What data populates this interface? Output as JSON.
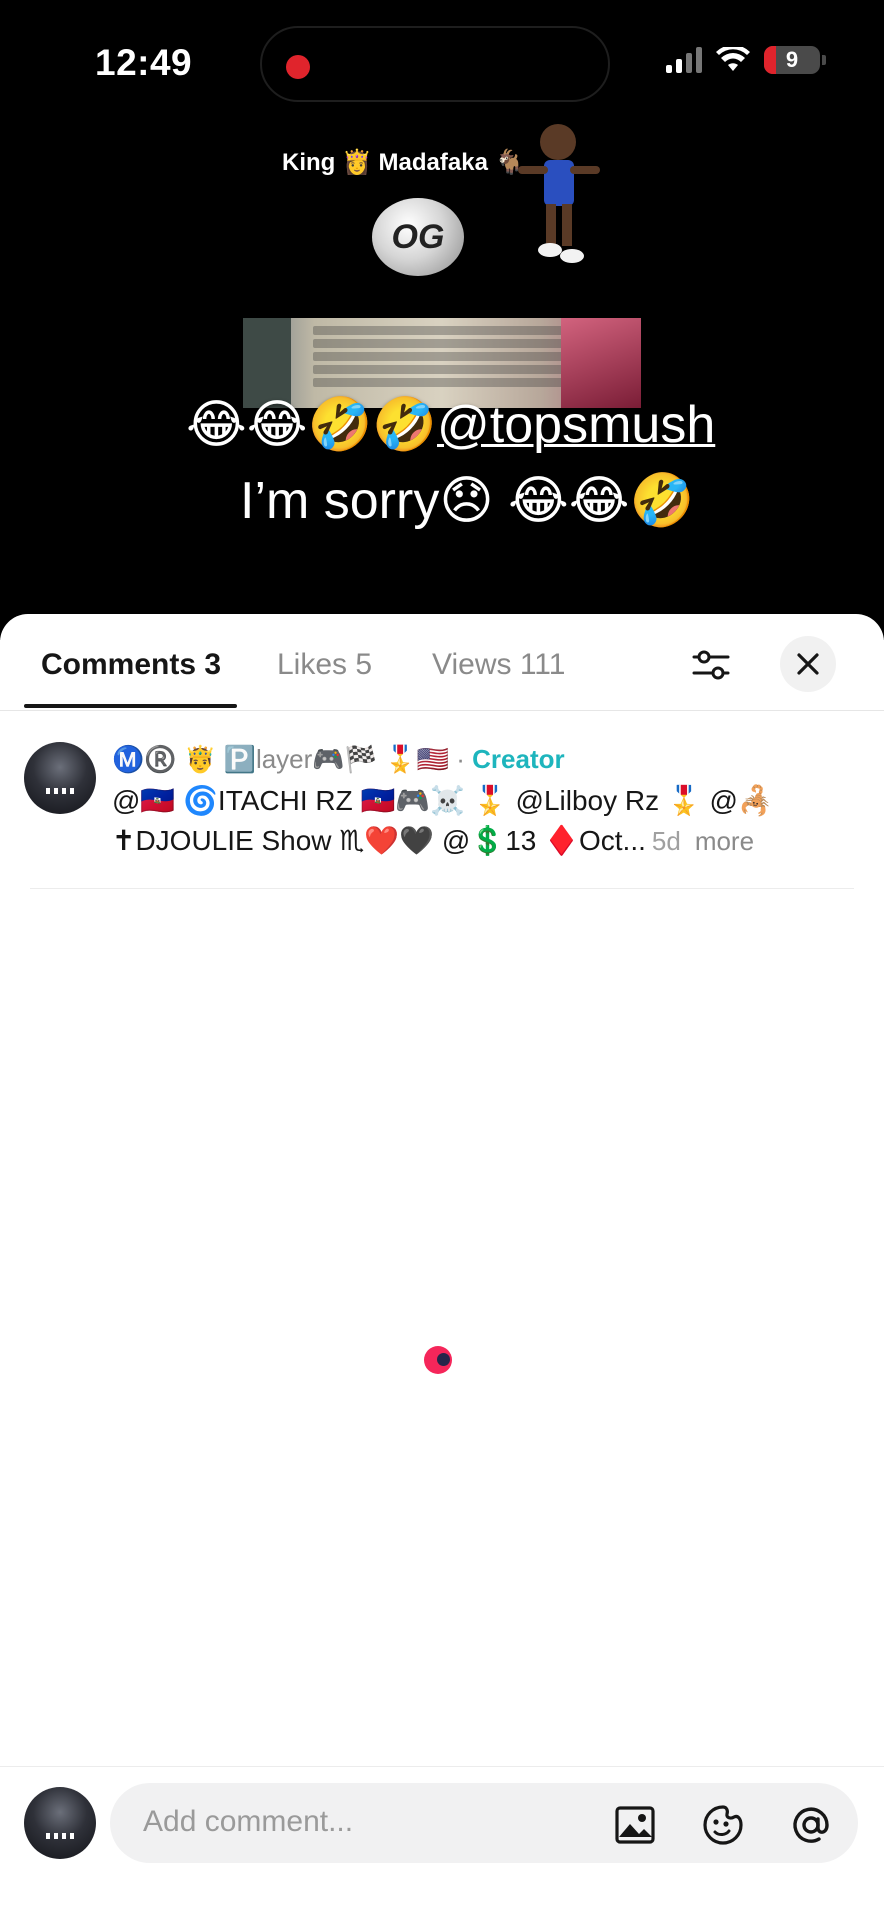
{
  "status_bar": {
    "time": "12:49",
    "battery": "9",
    "icons": [
      "recording-dot-icon",
      "signal-icon",
      "wifi-icon",
      "battery-icon"
    ]
  },
  "video": {
    "title": "King 👸 Madafaka 🐐",
    "logo_text": "OG",
    "caption_emoji": "😂😂🤣🤣",
    "caption_mention": "@topsmush",
    "caption_line2": "I’m sorry😞 😂😂🤣"
  },
  "tabs": [
    {
      "label": "Comments 3",
      "active": true
    },
    {
      "label": "Likes 5",
      "active": false
    },
    {
      "label": "Views 111",
      "active": false
    }
  ],
  "comment": {
    "username": "Ⓜ️®️ 🤴 🅿️layer🎮🏁 🎖️🇺🇸",
    "separator": " · ",
    "creator_label": "Creator",
    "line1": "@🇭🇹 🌀ITACHI RZ 🇭🇹🎮☠️ 🎖️ @Lilboy Rz 🎖️ @🦂",
    "line2": "✝DJOULIE Show ♏❤️🖤 @💲13 ♦️Oct...",
    "time": "5d",
    "more": "more"
  },
  "input": {
    "placeholder": "Add comment..."
  },
  "colors": {
    "accent_creator": "#1eb5bd",
    "record_red": "#e0242c",
    "loader_pink": "#f5265a",
    "loader_navy": "#25254a"
  }
}
